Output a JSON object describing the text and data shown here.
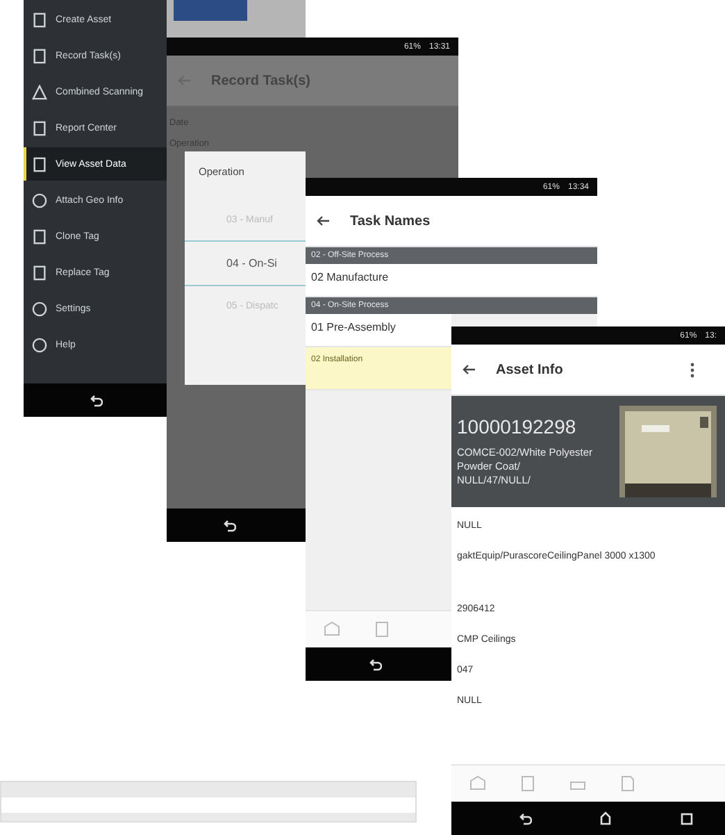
{
  "drawer_screen": {
    "menu_items": [
      {
        "label": "Create Asset",
        "kind": "box",
        "selected": false
      },
      {
        "label": "Record Task(s)",
        "kind": "doc",
        "selected": false
      },
      {
        "label": "Combined Scanning",
        "kind": "tri",
        "selected": false
      },
      {
        "label": "Report Center",
        "kind": "doc",
        "selected": false
      },
      {
        "label": "View Asset Data",
        "kind": "doc",
        "selected": true
      },
      {
        "label": "Attach Geo Info",
        "kind": "globe",
        "selected": false
      },
      {
        "label": "Clone Tag",
        "kind": "copy",
        "selected": false
      },
      {
        "label": "Replace Tag",
        "kind": "copy",
        "selected": false
      },
      {
        "label": "Settings",
        "kind": "gear",
        "selected": false
      },
      {
        "label": "Help",
        "kind": "help",
        "selected": false
      }
    ]
  },
  "record_screen": {
    "battery": "61%",
    "time": "13:31",
    "title": "Record Task(s)",
    "field_labels": [
      "Date",
      "Operation"
    ],
    "dialog": {
      "title": "Operation",
      "options": [
        {
          "label": "03 - Manuf",
          "selected": false
        },
        {
          "label": "04 - On-Si",
          "selected": true
        },
        {
          "label": "05 - Dispatc",
          "selected": false
        }
      ]
    }
  },
  "task_screen": {
    "battery": "61%",
    "time": "13:34",
    "title": "Task Names",
    "groups": [
      {
        "header": "02 - Off-Site Process",
        "tasks": [
          {
            "name": "02 Manufacture",
            "highlighted": false
          }
        ]
      },
      {
        "header": "04 - On-Site Process",
        "tasks": [
          {
            "name": "01 Pre-Assembly",
            "highlighted": false
          },
          {
            "name": "02 Installation",
            "highlighted": true
          }
        ]
      }
    ]
  },
  "asset_screen": {
    "battery": "61%",
    "time": "13:",
    "title": "Asset Info",
    "asset_number": "10000192298",
    "description": "COMCE-002/White Polyester Powder Coat/ NULL/47/NULL/",
    "fields": [
      "NULL",
      "gaktEquip/PurascoreCeilingPanel 3000 x1300",
      "2906412",
      "CMP Ceilings",
      "047",
      "NULL"
    ]
  }
}
